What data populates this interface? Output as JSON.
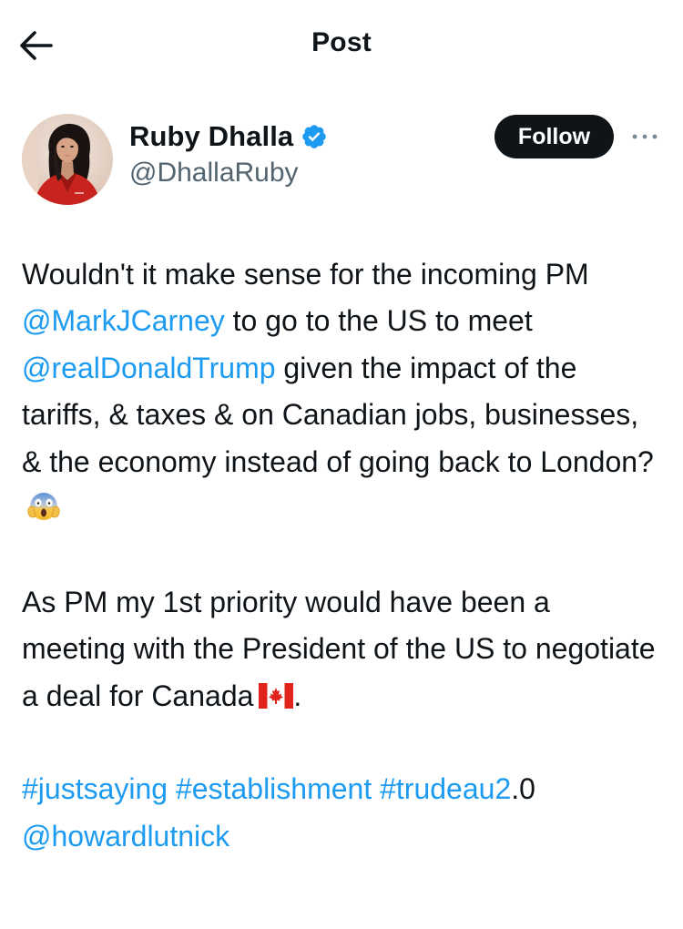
{
  "topbar": {
    "title": "Post",
    "back_icon": "arrow-left-icon"
  },
  "author": {
    "display_name": "Ruby Dhalla",
    "handle": "@DhallaRuby",
    "verified_icon": "verified-badge-icon",
    "avatar_icon": "avatar-photo"
  },
  "actions": {
    "follow_label": "Follow",
    "more_icon": "more-options-icon"
  },
  "tweet": {
    "p1": {
      "t1": "Wouldn't it make sense for the incoming PM ",
      "m1": "@MarkJCarney",
      "t2": "  to go to the US to meet ",
      "m2": "@realDonaldTrump",
      "t3": " given the impact of the tariffs, & taxes & on Canadian jobs, businesses, & the economy instead of going back to London?",
      "emoji": "face-screaming-in-fear-emoji"
    },
    "p2": {
      "t1": "As PM my 1st priority would have been a meeting with the President of the US to negotiate a deal for Canada",
      "flag": "canada-flag-emoji",
      "t2": "."
    },
    "p3": {
      "h1": "#justsaying",
      "h2": "#establishment",
      "h3": "#trudeau2",
      "t1": ".0",
      "m1": "@howardlutnick"
    }
  },
  "colors": {
    "text": "#0f1419",
    "secondary": "#536471",
    "link": "#1d9bf0",
    "verified": "#1d9bf0",
    "follow_bg": "#0f1419"
  }
}
